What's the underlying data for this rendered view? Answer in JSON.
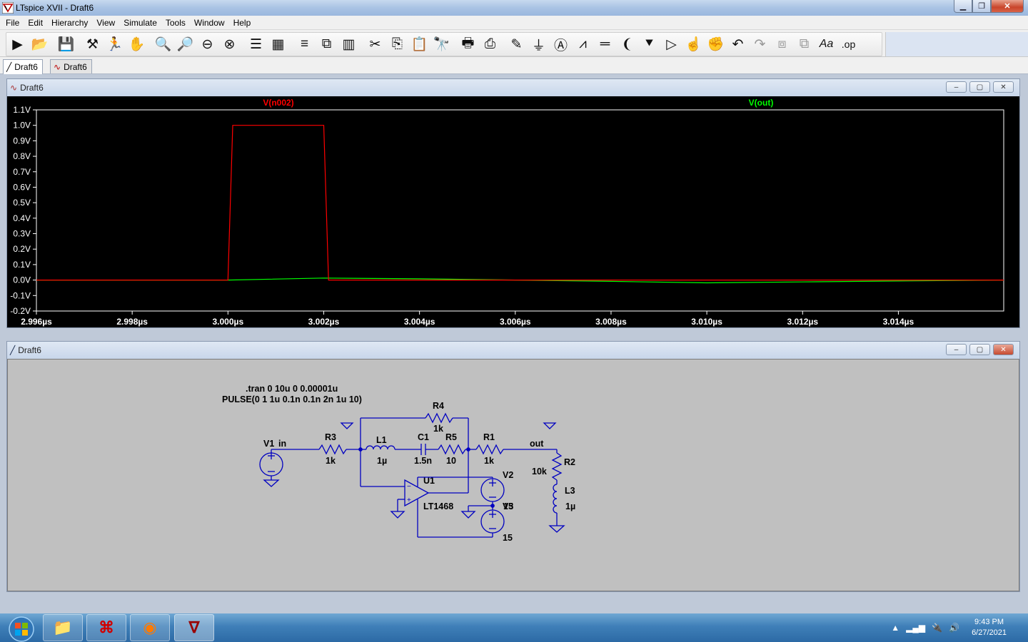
{
  "window": {
    "title": "LTspice XVII - Draft6"
  },
  "menu": [
    "File",
    "Edit",
    "Hierarchy",
    "View",
    "Simulate",
    "Tools",
    "Window",
    "Help"
  ],
  "toolbar": {
    "icons": [
      "run-icon",
      "open-icon",
      "save-icon",
      "control-panel-icon",
      "halt-icon",
      "pan-icon",
      "zoom-in-icon",
      "zoom-area-icon",
      "zoom-out-icon",
      "zoom-fit-icon",
      "autorange-icon",
      "setup-icon",
      "tile-horizontal-icon",
      "cascade-icon",
      "tile-vertical-icon",
      "cut-icon",
      "copy-icon",
      "paste-icon",
      "find-icon",
      "print-icon",
      "print-setup-icon",
      "wire-icon",
      "ground-icon",
      "label-icon",
      "resistor-icon",
      "capacitor-icon",
      "inductor-icon",
      "diode-icon",
      "component-icon",
      "rotate-icon",
      "mirror-icon",
      "undo-icon",
      "redo-icon",
      "drag-icon",
      "move-icon",
      "text-icon",
      "spice-directive-icon"
    ]
  },
  "tabs": [
    {
      "label": "Draft6",
      "icon": "schematic-icon",
      "active": true
    },
    {
      "label": "Draft6",
      "icon": "waveform-icon",
      "active": false
    }
  ],
  "plot_window": {
    "title": "Draft6"
  },
  "schematic_window": {
    "title": "Draft6"
  },
  "chart_data": {
    "type": "line",
    "x_unit": "µs",
    "xlim": [
      2.996,
      3.0162
    ],
    "ylim": [
      -0.2,
      1.1
    ],
    "yticks": [
      "1.1V",
      "1.0V",
      "0.9V",
      "0.8V",
      "0.7V",
      "0.6V",
      "0.5V",
      "0.4V",
      "0.3V",
      "0.2V",
      "0.1V",
      "0.0V",
      "-0.1V",
      "-0.2V"
    ],
    "ytick_values": [
      1.1,
      1.0,
      0.9,
      0.8,
      0.7,
      0.6,
      0.5,
      0.4,
      0.3,
      0.2,
      0.1,
      0.0,
      -0.1,
      -0.2
    ],
    "xticks": [
      "2.996µs",
      "2.998µs",
      "3.000µs",
      "3.002µs",
      "3.004µs",
      "3.006µs",
      "3.008µs",
      "3.010µs",
      "3.012µs",
      "3.014µs"
    ],
    "xtick_values": [
      2.996,
      2.998,
      3.0,
      3.002,
      3.004,
      3.006,
      3.008,
      3.01,
      3.012,
      3.014
    ],
    "series": [
      {
        "name": "V(n002)",
        "color": "#ff0000",
        "x": [
          2.996,
          3.0,
          3.0001,
          3.002,
          3.0021,
          3.0162
        ],
        "y": [
          0.0,
          0.0,
          1.0,
          1.0,
          0.0,
          0.0
        ]
      },
      {
        "name": "V(out)",
        "color": "#00ff00",
        "x": [
          2.996,
          3.0,
          3.002,
          3.004,
          3.006,
          3.008,
          3.01,
          3.012,
          3.014,
          3.0162
        ],
        "y": [
          0.0,
          0.0,
          0.013,
          0.008,
          0.0,
          -0.008,
          -0.018,
          -0.012,
          -0.006,
          0.0
        ]
      }
    ]
  },
  "schematic": {
    "directive": ".tran 0 10u 0 0.00001u",
    "pulse": "PULSE(0 1 1u 0.1n 0.1n 2n 1u 10)",
    "components": {
      "v1": {
        "name": "V1",
        "net": "in"
      },
      "r3": {
        "name": "R3",
        "value": "1k"
      },
      "l1": {
        "name": "L1",
        "value": "1µ"
      },
      "c1": {
        "name": "C1",
        "value": "1.5n"
      },
      "r5": {
        "name": "R5",
        "value": "10"
      },
      "r4": {
        "name": "R4",
        "value": "1k"
      },
      "r1": {
        "name": "R1",
        "value": "1k"
      },
      "out": {
        "net": "out"
      },
      "r2": {
        "name": "R2",
        "value": "10k"
      },
      "l3": {
        "name": "L3",
        "value": "1µ"
      },
      "u1": {
        "name": "U1",
        "value": "LT1468"
      },
      "v2": {
        "name": "V2"
      },
      "v3": {
        "name": "V3",
        "overlap": "15"
      },
      "v3_value": "15"
    }
  },
  "taskbar": {
    "apps": [
      "explorer-icon",
      "acrobat-icon",
      "firefox-icon",
      "ltspice-icon"
    ],
    "time": "9:43 PM",
    "date": "6/27/2021"
  }
}
